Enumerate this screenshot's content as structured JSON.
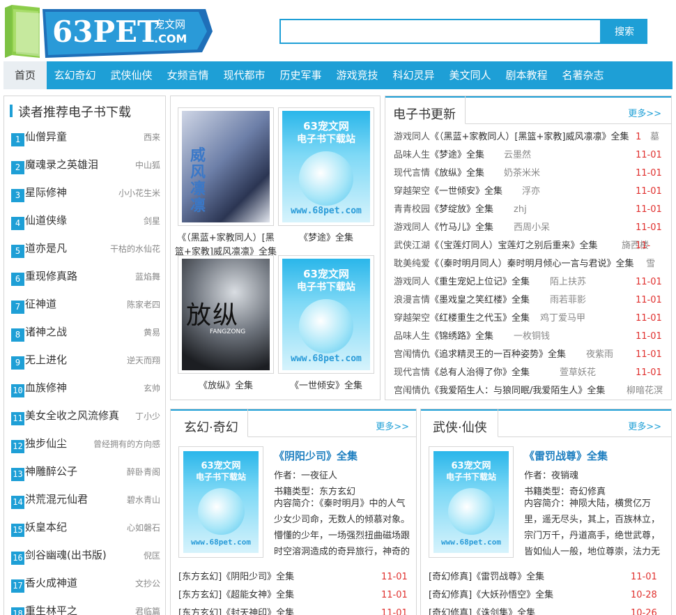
{
  "site": {
    "logo_text": "63PET",
    "logo_sub": ".COM",
    "logo_cn": "宠文网"
  },
  "search": {
    "button": "搜索",
    "placeholder": ""
  },
  "nav": [
    "首页",
    "玄幻奇幻",
    "武侠仙侠",
    "女频言情",
    "现代都市",
    "历史军事",
    "游戏竞技",
    "科幻灵异",
    "美文同人",
    "剧本教程",
    "名著杂志"
  ],
  "recommend": {
    "title": "读者推荐电子书下载",
    "items": [
      {
        "n": "1",
        "title": "仙僧异童",
        "author": "西来"
      },
      {
        "n": "2",
        "title": "魔魂录之英雄泪",
        "author": "中山狐"
      },
      {
        "n": "3",
        "title": "星际修神",
        "author": "小小花生米"
      },
      {
        "n": "4",
        "title": "仙道侠缘",
        "author": "剑星"
      },
      {
        "n": "5",
        "title": "道亦是凡",
        "author": "干枯的水仙花"
      },
      {
        "n": "6",
        "title": "重现修真路",
        "author": "蓝焰舞"
      },
      {
        "n": "7",
        "title": "征神道",
        "author": "陈家老四"
      },
      {
        "n": "8",
        "title": "诸神之战",
        "author": "黄易"
      },
      {
        "n": "9",
        "title": "无上进化",
        "author": "逆天而翔"
      },
      {
        "n": "10",
        "title": "血族修神",
        "author": "玄帅"
      },
      {
        "n": "11",
        "title": "美女全收之风流修真",
        "author": "丁小少"
      },
      {
        "n": "12",
        "title": "独步仙尘",
        "author": "曾经拥有的方向感"
      },
      {
        "n": "13",
        "title": "神雕醉公子",
        "author": "醉卧青阁"
      },
      {
        "n": "14",
        "title": "洪荒混元仙君",
        "author": "碧水青山"
      },
      {
        "n": "15",
        "title": "妖皇本纪",
        "author": "心如磐石"
      },
      {
        "n": "16",
        "title": "剑谷幽魂(出书版)",
        "author": "倪匡"
      },
      {
        "n": "17",
        "title": "香火成神道",
        "author": "文抄公"
      },
      {
        "n": "18",
        "title": "重生林平之",
        "author": "君临篇"
      }
    ]
  },
  "placeholder": {
    "line1": "63宠文网",
    "line2": "电子书下载站",
    "url": "www.68pet.com"
  },
  "covers": [
    {
      "caption": "《（黑蓝+家教同人）[黑篮+家教]威风凛凛》全集",
      "art_title": "威风凛凛"
    },
    {
      "caption": "《梦途》全集"
    },
    {
      "caption": "《放纵》全集",
      "art_title": "放纵",
      "art_sub": "FANGZONG"
    },
    {
      "caption": "《一世倾安》全集"
    }
  ],
  "updates": {
    "title": "电子书更新",
    "more": "更多>>",
    "rows": [
      {
        "cat": "游戏同人",
        "book": "《（黑蓝+家教同人）[黑篮+家教]威风凛凛》全集",
        "author": "墓",
        "date": "1"
      },
      {
        "cat": "品味人生",
        "book": "《梦途》全集",
        "author": "云墨然",
        "date": "11-01"
      },
      {
        "cat": "现代言情",
        "book": "《放纵》全集",
        "author": "奶茶米米",
        "date": "11-01"
      },
      {
        "cat": "穿越架空",
        "book": "《一世倾安》全集",
        "author": "浮亦",
        "date": "11-01"
      },
      {
        "cat": "青青校园",
        "book": "《梦绽放》全集",
        "author": "zhj",
        "date": "11-01"
      },
      {
        "cat": "游戏同人",
        "book": "《竹马儿》全集",
        "author": "西周小呆",
        "date": "11-01"
      },
      {
        "cat": "武侠江湖",
        "book": "《（宝莲灯同人）宝莲灯之别后重来》全集",
        "author": "旖西楼",
        "date": "11-"
      },
      {
        "cat": "耽美纯爱",
        "book": "《（秦时明月同人）秦时明月倾心一言与君说》全集",
        "author": "雪",
        "date": ""
      },
      {
        "cat": "游戏同人",
        "book": "《重生宠妃上位记》全集",
        "author": "陌上扶苏",
        "date": "11-01"
      },
      {
        "cat": "浪漫言情",
        "book": "《墨戏皇之笑红楼》全集",
        "author": "雨若菲影",
        "date": "11-01"
      },
      {
        "cat": "穿越架空",
        "book": "《红楼重生之代玉》全集",
        "author": "鸡丁爱马甲",
        "date": "11-01"
      },
      {
        "cat": "品味人生",
        "book": "《锦绣路》全集",
        "author": "一枚铜钱",
        "date": "11-01"
      },
      {
        "cat": "宫闱情仇",
        "book": "《追求精灵王的一百种姿势》全集",
        "author": "夜紫雨",
        "date": "11-01"
      },
      {
        "cat": "现代言情",
        "book": "《总有人治得了你》全集",
        "author": "萱草妖花",
        "date": "11-01"
      },
      {
        "cat": "宫闱情仇",
        "book": "《我爱陌生人：与狼同眠/我爱陌生人》全集",
        "author": "柳暗花溟",
        "date": ""
      }
    ]
  },
  "xuanhuan": {
    "title": "玄幻·奇幻",
    "more": "更多>>",
    "feature": {
      "title": "《阴阳少司》全集",
      "author_label": "作者：一夜征人",
      "type_label": "书籍类型：东方玄幻",
      "intro": "内容简介：《秦时明月》中的人气少女少司命，无数人的倾慕对象。懵懂的少年，一场强烈扭曲磁场跟时空溶洞造成的奇异旅行，神奇的"
    },
    "list": [
      {
        "text": "[东方玄幻]《阴阳少司》全集",
        "date": "11-01"
      },
      {
        "text": "[东方玄幻]《超能女神》全集",
        "date": "11-01"
      },
      {
        "text": "[东方玄幻]《封天神印》全集",
        "date": "11-01"
      }
    ]
  },
  "wuxia": {
    "title": "武侠·仙侠",
    "more": "更多>>",
    "feature": {
      "title": "《雷罚战尊》全集",
      "author_label": "作者：夜销魂",
      "type_label": "书籍类型：奇幻修真",
      "intro": "内容简介：神陨大陆，横贯亿万里，遥无尽头，其上，百族林立，宗门万千，丹道高手，绝世武尊，皆如仙人一般，地位尊崇，法力无"
    },
    "list": [
      {
        "text": "[奇幻修真]《雷罚战尊》全集",
        "date": "11-01"
      },
      {
        "text": "[奇幻修真]《大妖孙悟空》全集",
        "date": "10-28"
      },
      {
        "text": "[奇幻修真]《诛剑集》全集",
        "date": "10-26"
      }
    ]
  }
}
